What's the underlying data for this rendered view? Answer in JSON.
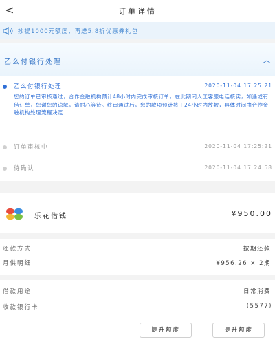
{
  "header": {
    "back_glyph": "<",
    "title": "订单详情"
  },
  "notice": {
    "icon": "speaker-icon",
    "text": "抄提1000元额度，再送5.8折优惠券礼包"
  },
  "bank": {
    "name": "乙么付银行处理",
    "toggle_glyph": "︿"
  },
  "timeline": {
    "items": [
      {
        "title": "乙么付银行处理",
        "time": "2020-11-04 17:25:21",
        "desc": "您的订单已审核通过，合作金融机构预计48小时内完成审核订单，在此期间人工客服电话核实，如遇或有借订单，您谢您的谅解，请耐心等待。终审通过后，您的款项预计将于24小时内放款，具体时间由合作金融机构处理流程决定",
        "active": true
      },
      {
        "title": "订单审核中",
        "time": "2020-11-04 17:25:21",
        "active": false
      },
      {
        "title": "待确认",
        "time": "2020-11-04 17:24:58",
        "active": false
      }
    ]
  },
  "product": {
    "logo_colors": [
      "#e84c3d",
      "#3c8ee0",
      "#f2b632",
      "#7ac143"
    ],
    "name": "乐花借钱",
    "amount": "¥950.00"
  },
  "details": [
    {
      "label": "还款方式",
      "value": "按期还款"
    },
    {
      "label": "月供明细",
      "value": "¥956.26 × 2期"
    },
    {
      "label": "借款用途",
      "value": "日常消费"
    },
    {
      "label": "收款银行卡",
      "value": "(5577)"
    }
  ],
  "buttons": {
    "left": "提升额度",
    "right": "提升额度"
  }
}
